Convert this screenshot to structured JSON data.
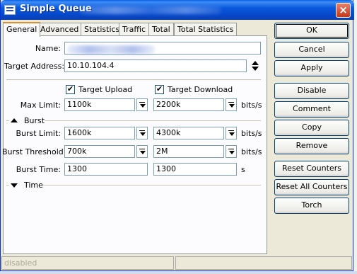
{
  "window": {
    "title": "Simple Queue",
    "close_label": "×"
  },
  "tabs": [
    {
      "label": "General"
    },
    {
      "label": "Advanced"
    },
    {
      "label": "Statistics"
    },
    {
      "label": "Traffic"
    },
    {
      "label": "Total"
    },
    {
      "label": "Total Statistics"
    }
  ],
  "form": {
    "name_label": "Name:",
    "name_value": "",
    "target_address_label": "Target Address:",
    "target_address_value": "10.10.104.4",
    "target_upload_label": "Target Upload",
    "target_download_label": "Target Download",
    "checkbox_mark": "✔",
    "max_limit_label": "Max Limit:",
    "max_limit_upload": "1100k",
    "max_limit_download": "2200k",
    "unit_bits": "bits/s",
    "burst_section": "Burst",
    "burst_limit_label": "Burst Limit:",
    "burst_limit_upload": "1600k",
    "burst_limit_download": "4300k",
    "burst_threshold_label": "Burst Threshold:",
    "burst_threshold_upload": "700k",
    "burst_threshold_download": "2M",
    "burst_time_label": "Burst Time:",
    "burst_time_upload": "1300",
    "burst_time_download": "1300",
    "unit_seconds": "s",
    "time_section": "Time"
  },
  "buttons": {
    "ok": "OK",
    "cancel": "Cancel",
    "apply": "Apply",
    "disable": "Disable",
    "comment": "Comment",
    "copy": "Copy",
    "remove": "Remove",
    "reset_counters": "Reset Counters",
    "reset_all_counters": "Reset All Counters",
    "torch": "Torch"
  },
  "status": {
    "text": "disabled"
  },
  "colors": {
    "titlebar": "#0a58dc",
    "window_bg": "#ece9d8",
    "tab_active_accent": "#e68b2c",
    "close": "#c2381a"
  }
}
